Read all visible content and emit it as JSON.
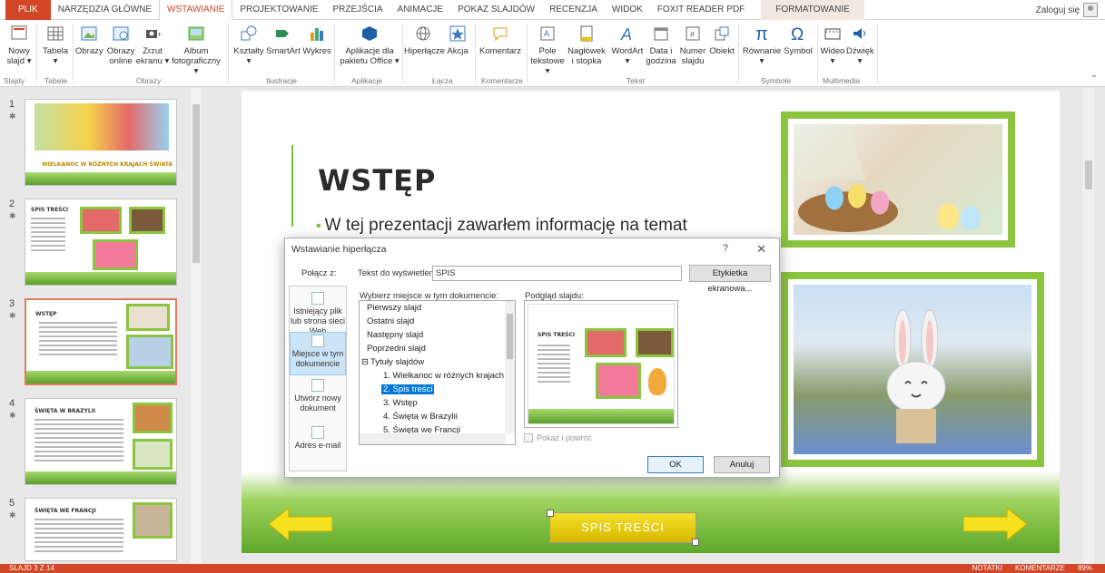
{
  "ribbon_tabs": [
    "PLIK",
    "NARZĘDZIA GŁÓWNE",
    "WSTAWIANIE",
    "PROJEKTOWANIE",
    "PRZEJŚCIA",
    "ANIMACJE",
    "POKAZ SLAJDÓW",
    "RECENZJA",
    "WIDOK",
    "FOXIT READER PDF",
    "FORMATOWANIE"
  ],
  "signin": "Zaloguj się",
  "ribbon": {
    "buttons": [
      {
        "line1": "Nowy",
        "line2": "slajd ▾"
      },
      {
        "line1": "Tabela",
        "line2": "▾"
      },
      {
        "line1": "Obrazy",
        "line2": ""
      },
      {
        "line1": "Obrazy",
        "line2": "online"
      },
      {
        "line1": "Zrzut",
        "line2": "ekranu ▾"
      },
      {
        "line1": "Album",
        "line2": "fotograficzny ▾"
      },
      {
        "line1": "Kształty",
        "line2": "▾"
      },
      {
        "line1": "SmartArt",
        "line2": ""
      },
      {
        "line1": "Wykres",
        "line2": ""
      },
      {
        "line1": "Aplikacje dla",
        "line2": "pakietu Office ▾"
      },
      {
        "line1": "Hiperłącze",
        "line2": ""
      },
      {
        "line1": "Akcja",
        "line2": ""
      },
      {
        "line1": "Komentarz",
        "line2": ""
      },
      {
        "line1": "Pole",
        "line2": "tekstowe ▾"
      },
      {
        "line1": "Nagłówek",
        "line2": "i stopka"
      },
      {
        "line1": "WordArt",
        "line2": "▾"
      },
      {
        "line1": "Data i",
        "line2": "godzina"
      },
      {
        "line1": "Numer",
        "line2": "slajdu"
      },
      {
        "line1": "Obiekt",
        "line2": ""
      },
      {
        "line1": "Równanie",
        "line2": "▾"
      },
      {
        "line1": "Symbol",
        "line2": ""
      },
      {
        "line1": "Wideo",
        "line2": "▾"
      },
      {
        "line1": "Dźwięk",
        "line2": "▾"
      }
    ],
    "groups": [
      "Slajdy",
      "Tabele",
      "Obrazy",
      "Ilustracje",
      "Aplikacje",
      "Łącza",
      "Komentarze",
      "Tekst",
      "Symbole",
      "Multimedia"
    ]
  },
  "thumbnails": [
    {
      "num": "1",
      "title": "WIELKANOC W RÓŻNYCH KRAJACH ŚWIATA"
    },
    {
      "num": "2",
      "title": "SPIS TREŚCI"
    },
    {
      "num": "3",
      "title": "WSTĘP"
    },
    {
      "num": "4",
      "title": "ŚWIĘTA W BRAZYLII"
    },
    {
      "num": "5",
      "title": "ŚWIĘTA WE FRANCJI"
    }
  ],
  "slide": {
    "title": "WSTĘP",
    "body": "W tej prezentacji zawarłem informację na temat",
    "button": "SPIS TREŚCI"
  },
  "dialog": {
    "title": "Wstawianie hiperłącza",
    "help": "?",
    "close": "✕",
    "link_to": "Połącz z:",
    "display_text_label": "Tekst do wyświetlenia:",
    "display_text_value": "SPIS",
    "screentip": "Etykietka ekranowa...",
    "place_label": "Wybierz miejsce w tym dokumencie:",
    "preview_label": "Podgląd slajdu:",
    "link_options": [
      {
        "label": "Istniejący plik lub strona sieci Web"
      },
      {
        "label": "Miejsce w tym dokumencie"
      },
      {
        "label": "Utwórz nowy dokument"
      },
      {
        "label": "Adres e-mail"
      }
    ],
    "tree": [
      {
        "label": "Pierwszy slajd"
      },
      {
        "label": "Ostatni slajd"
      },
      {
        "label": "Następny slajd"
      },
      {
        "label": "Poprzedni slajd"
      },
      {
        "label": "Tytuły slajdów"
      },
      {
        "label": "1. Wielkanoc w różnych krajach ś"
      },
      {
        "label": "2. Spis treści"
      },
      {
        "label": "3. Wstęp"
      },
      {
        "label": "4. Święta w Brazylii"
      },
      {
        "label": "5. Święta we Francji"
      }
    ],
    "preview_title": "SPIS TREŚCI",
    "show_return": "Pokaż i powróć",
    "ok": "OK",
    "cancel": "Anuluj"
  },
  "statusbar": {
    "left": "SLAJD 3 Z 14",
    "notes": "NOTATKI",
    "comments": "KOMENTARZE",
    "zoom": "89%"
  },
  "colors": {
    "accent": "#d24726",
    "green": "#8bc53f",
    "select": "#0078d7"
  }
}
